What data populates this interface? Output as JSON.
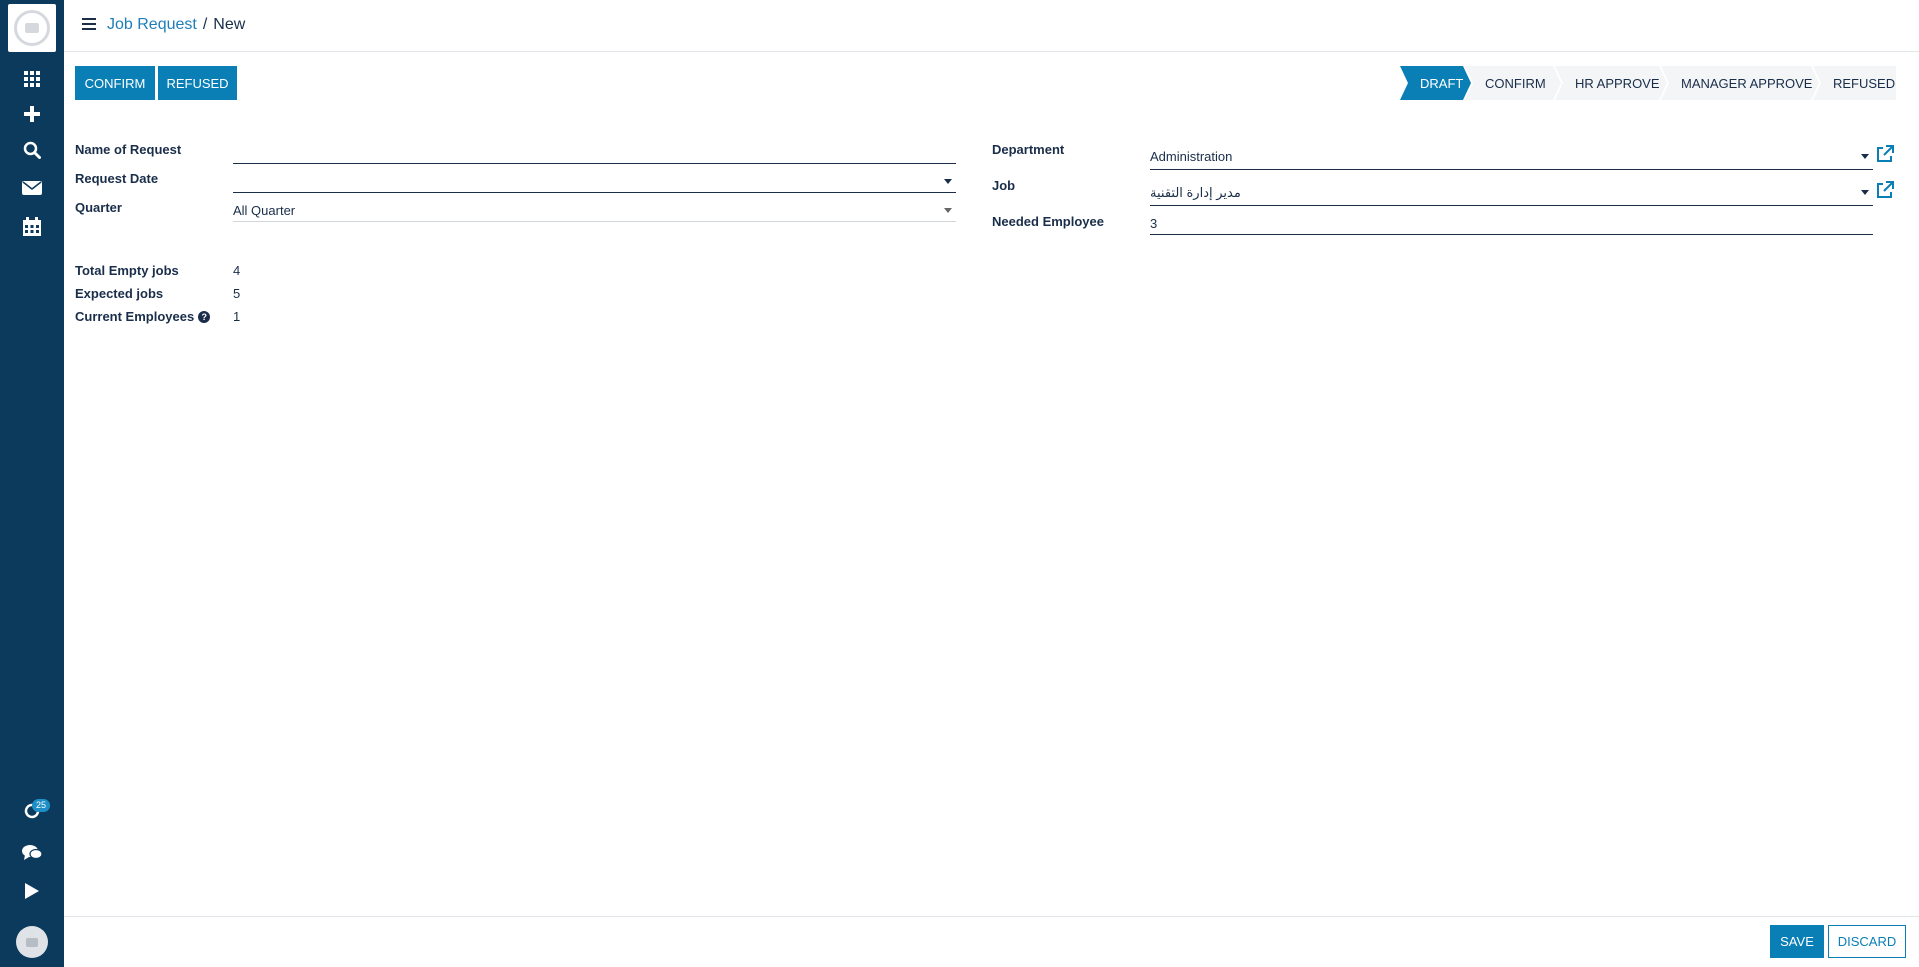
{
  "header": {
    "breadcrumb_parent": "Job Request",
    "breadcrumb_separator": "/",
    "breadcrumb_current": "New"
  },
  "actions": {
    "confirm_label": "CONFIRM",
    "refused_label": "REFUSED"
  },
  "statusbar": {
    "stages": [
      "DRAFT",
      "CONFIRM",
      "HR APPROVE",
      "MANAGER APPROVE",
      "REFUSED"
    ],
    "active": "DRAFT"
  },
  "form": {
    "name_of_request_label": "Name of Request",
    "name_of_request_value": "",
    "request_date_label": "Request Date",
    "request_date_value": "",
    "quarter_label": "Quarter",
    "quarter_value": "All Quarter",
    "department_label": "Department",
    "department_value": "Administration",
    "job_label": "Job",
    "job_value": "مدير إدارة التقنية",
    "needed_employee_label": "Needed Employee",
    "needed_employee_value": "3",
    "total_empty_jobs_label": "Total Empty jobs",
    "total_empty_jobs_value": "4",
    "expected_jobs_label": "Expected jobs",
    "expected_jobs_value": "5",
    "current_employees_label": "Current Employees",
    "current_employees_value": "1",
    "help_glyph": "?"
  },
  "sidebar": {
    "activity_badge": "25",
    "icons": [
      "apps-icon",
      "plus-icon",
      "search-icon",
      "mail-icon",
      "calendar-icon",
      "activity-icon",
      "chat-icon",
      "play-icon"
    ]
  },
  "footer": {
    "save_label": "SAVE",
    "discard_label": "DISCARD"
  },
  "colors": {
    "sidebar": "#0b3a5c",
    "primary": "#0a7fb6",
    "text": "#1a2e4a",
    "link": "#1e7fb8"
  }
}
